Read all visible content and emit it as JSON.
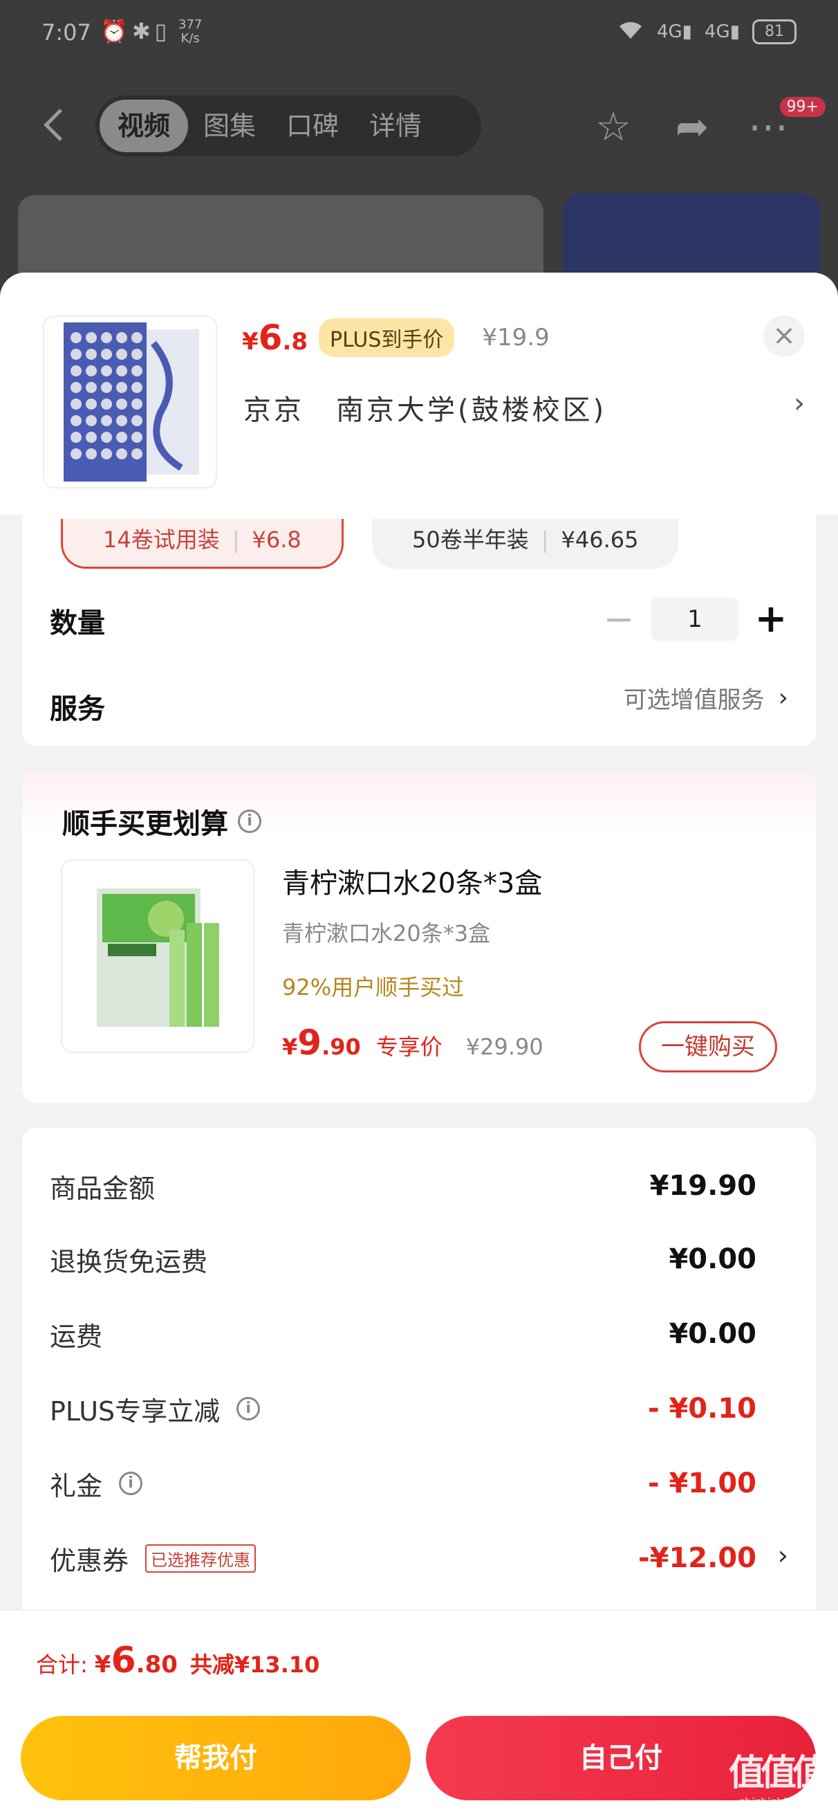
{
  "status_bar": {
    "time": "7:07",
    "left_icons": "⏰✱▯",
    "speed_value": "377",
    "speed_unit": "K/s",
    "network_1": "4G",
    "network_2": "4G",
    "battery": "81"
  },
  "background_nav": {
    "tabs": [
      "视频",
      "图集",
      "口碑",
      "详情"
    ],
    "active_tab": 0,
    "badge": "99+"
  },
  "sheet": {
    "price": {
      "yen": "¥",
      "int": "6",
      "dec": ".8"
    },
    "plus_tag": "PLUS到手价",
    "orig_price": "¥19.9",
    "close_label": "×",
    "address": {
      "city": "京京",
      "location": "南京大学(鼓楼校区)"
    },
    "specs": [
      {
        "name": "14卷试用装",
        "price": "¥6.8",
        "selected": true
      },
      {
        "name": "50卷半年装",
        "price": "¥46.65",
        "selected": false
      }
    ],
    "quantity": {
      "label": "数量",
      "value": "1",
      "minus": "−",
      "plus": "+"
    },
    "service": {
      "label": "服务",
      "value": "可选增值服务"
    }
  },
  "bundle": {
    "title": "顺手买更划算",
    "name": "青柠漱口水20条*3盒",
    "subtitle": "青柠漱口水20条*3盒",
    "percent_text": "92%用户顺手买过",
    "price": {
      "yen": "¥",
      "int": "9",
      "dec": ".90"
    },
    "price_tag": "专享价",
    "orig_price": "¥29.90",
    "buy_label": "一键购买"
  },
  "fees": [
    {
      "label": "商品金额",
      "value": "¥19.90",
      "red": false,
      "info": false
    },
    {
      "label": "退换货免运费",
      "value": "¥0.00",
      "red": false,
      "info": false
    },
    {
      "label": "运费",
      "value": "¥0.00",
      "red": false,
      "info": false
    },
    {
      "label": "PLUS专享立减",
      "value": "- ¥0.10",
      "red": true,
      "info": true
    },
    {
      "label": "礼金",
      "value": "- ¥1.00",
      "red": true,
      "info": true
    },
    {
      "label": "优惠券",
      "value": "-¥12.00",
      "red": true,
      "info": false,
      "tag": "已选推荐优惠"
    }
  ],
  "footer": {
    "total_label": "合计:",
    "total": {
      "yen": "¥",
      "int": "6",
      "dec": ".80"
    },
    "total_cut": "共减¥13.10",
    "help_pay": "帮我付",
    "self_pay": "自己付"
  },
  "watermark": {
    "big": "值值值",
    "small": "zhizhizhi.com"
  },
  "colors": {
    "accent_red": "#e2231a",
    "plus_gold": "#fbe6a6",
    "help_btn": "#ffb40c",
    "self_btn": "#ee2b43"
  }
}
